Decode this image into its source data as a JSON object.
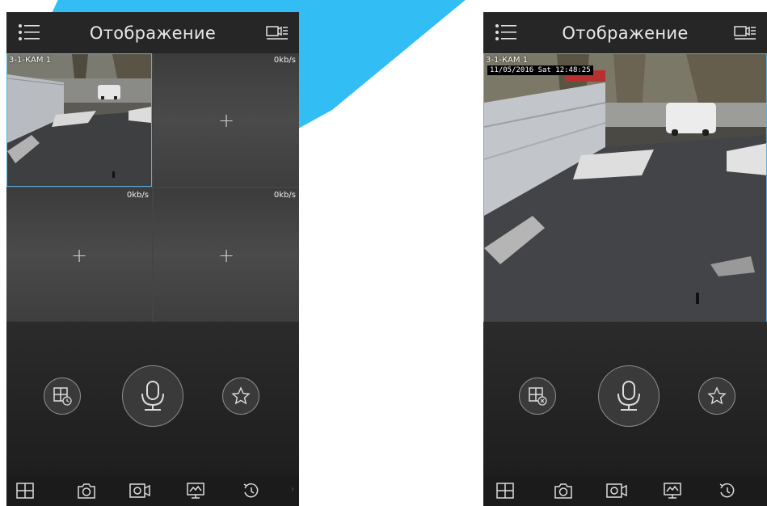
{
  "phones": [
    {
      "title": "Отображение",
      "cells": [
        {
          "camera_label": "3-1-КАМ 1",
          "rate": ""
        },
        {
          "camera_label": "",
          "rate": "0kb/s"
        },
        {
          "camera_label": "",
          "rate": "0kb/s"
        },
        {
          "camera_label": "",
          "rate": "0kb/s"
        }
      ],
      "add_symbol": "+"
    },
    {
      "title": "Отображение",
      "camera_label": "3-1-КАМ 1",
      "timestamp": "11/05/2016 Sat 12:48:25"
    }
  ],
  "icons": {
    "menu": "menu-icon",
    "camera_list": "camera-list-icon",
    "layout_schedule": "split-schedule-icon",
    "layout_close": "split-close-icon",
    "microphone": "microphone-icon",
    "favorite": "star-icon",
    "split": "grid-icon",
    "snapshot": "camera-icon",
    "record": "video-record-icon",
    "monitor": "monitor-icon",
    "playback": "playback-icon"
  },
  "colors": {
    "accent": "#33bdf5",
    "selection_border": "#5ab0d8",
    "topbar_bg": "#262626"
  }
}
